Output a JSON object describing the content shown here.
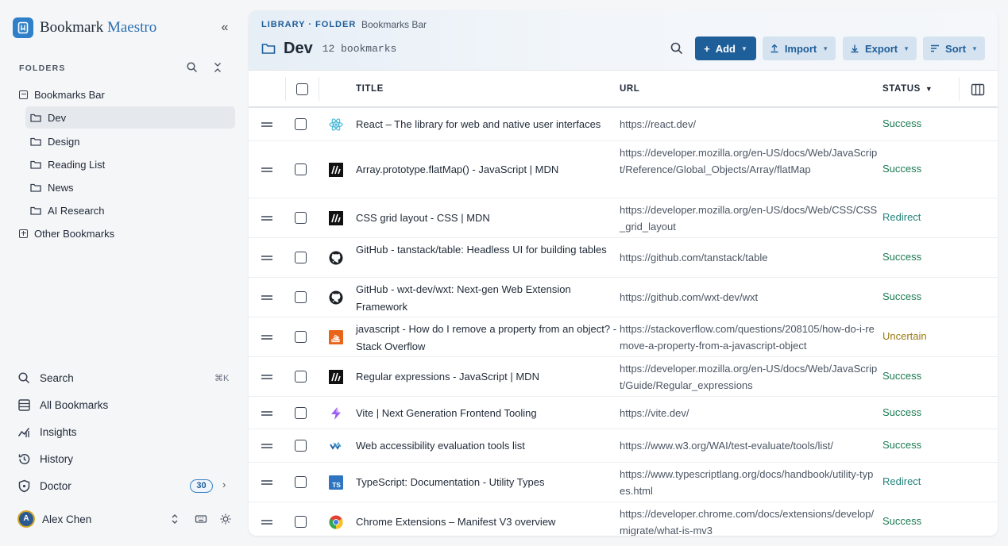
{
  "brand": {
    "name_part1": "Bookmark ",
    "name_part2": "Maestro"
  },
  "sidebar": {
    "folders_header": "FOLDERS",
    "tree": [
      {
        "label": "Bookmarks Bar"
      },
      {
        "label": "Dev"
      },
      {
        "label": "Design"
      },
      {
        "label": "Reading List"
      },
      {
        "label": "News"
      },
      {
        "label": "AI Research"
      },
      {
        "label": "Other Bookmarks"
      }
    ],
    "nav": [
      {
        "label": "Search",
        "shortcut": "⌘K"
      },
      {
        "label": "All Bookmarks"
      },
      {
        "label": "Insights"
      },
      {
        "label": "History"
      },
      {
        "label": "Doctor",
        "badge": "30"
      }
    ],
    "user": {
      "initial": "A",
      "name": "Alex Chen"
    }
  },
  "header": {
    "breadcrumb": "LIBRARY · FOLDER",
    "path": "Bookmarks Bar",
    "title": "Dev",
    "count": "12 bookmarks",
    "add_label": "Add",
    "import_label": "Import",
    "export_label": "Export",
    "sort_label": "Sort"
  },
  "table": {
    "columns": {
      "title": "TITLE",
      "url": "URL",
      "status": "STATUS"
    },
    "rows": [
      {
        "title": "React – The library for web and native user interfaces",
        "url": "https://react.dev/",
        "status": "Success",
        "icon": "react-icon"
      },
      {
        "title": "Array.prototype.flatMap() - JavaScript | MDN",
        "url": "https://developer.mozilla.org/en-US/docs/Web/JavaScript/Reference/Global_Objects/Array/flatMap",
        "status": "Success",
        "icon": "mdn-icon"
      },
      {
        "title": "CSS grid layout - CSS | MDN",
        "url": "https://developer.mozilla.org/en-US/docs/Web/CSS/CSS_grid_layout",
        "status": "Redirect",
        "icon": "mdn-icon"
      },
      {
        "title": "GitHub - tanstack/table: Headless UI for building tables",
        "url": "https://github.com/tanstack/table",
        "status": "Success",
        "icon": "github-icon"
      },
      {
        "title": "GitHub - wxt-dev/wxt: Next-gen Web Extension Framework",
        "url": "https://github.com/wxt-dev/wxt",
        "status": "Success",
        "icon": "github-icon"
      },
      {
        "title": "javascript - How do I remove a property from an object? - Stack Overflow",
        "url": "https://stackoverflow.com/questions/208105/how-do-i-remove-a-property-from-a-javascript-object",
        "status": "Uncertain",
        "icon": "stackoverflow-icon"
      },
      {
        "title": "Regular expressions - JavaScript | MDN",
        "url": "https://developer.mozilla.org/en-US/docs/Web/JavaScript/Guide/Regular_expressions",
        "status": "Success",
        "icon": "mdn-icon"
      },
      {
        "title": "Vite | Next Generation Frontend Tooling",
        "url": "https://vite.dev/",
        "status": "Success",
        "icon": "vite-icon"
      },
      {
        "title": "Web accessibility evaluation tools list",
        "url": "https://www.w3.org/WAI/test-evaluate/tools/list/",
        "status": "Success",
        "icon": "w3c-wai-icon"
      },
      {
        "title": "TypeScript: Documentation - Utility Types",
        "url": "https://www.typescriptlang.org/docs/handbook/utility-types.html",
        "status": "Redirect",
        "icon": "typescript-icon"
      },
      {
        "title": "Chrome Extensions – Manifest V3 overview",
        "url": "https://developer.chrome.com/docs/extensions/develop/migrate/what-is-mv3",
        "status": "Success",
        "icon": "chrome-icon"
      }
    ]
  },
  "colors": {
    "accent": "#1e5e99",
    "success": "#1b7a52",
    "redirect": "#23827a",
    "uncertain": "#9a7a12"
  }
}
